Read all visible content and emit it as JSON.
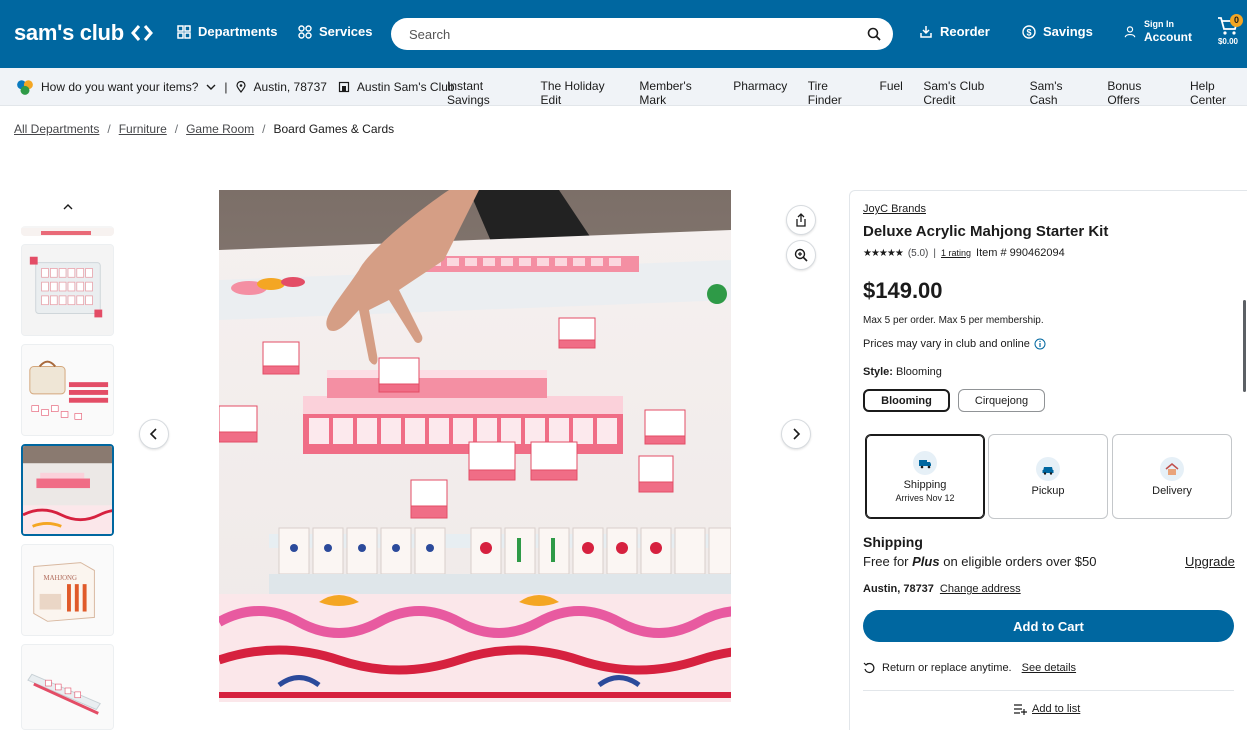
{
  "header": {
    "logo_text": "sam's club",
    "departments_label": "Departments",
    "services_label": "Services",
    "search_placeholder": "Search",
    "reorder_label": "Reorder",
    "savings_label": "Savings",
    "sign_in_label": "Sign In",
    "account_label": "Account",
    "cart_count": "0",
    "cart_total": "$0.00",
    "brand_color": "#0067a0"
  },
  "subnav": {
    "fulfillment_prompt": "How do you want your items?",
    "location": "Austin, 78737",
    "club": "Austin Sam's Club",
    "links": [
      "Instant Savings",
      "The Holiday Edit",
      "Member's Mark",
      "Pharmacy",
      "Tire Finder",
      "Fuel",
      "Sam's Club Credit",
      "Sam's Cash",
      "Bonus Offers",
      "Help Center"
    ]
  },
  "breadcrumbs": {
    "items": [
      "All Departments",
      "Furniture",
      "Game Room"
    ],
    "current": "Board Games & Cards",
    "separator": "/"
  },
  "product": {
    "brand": "JoyC Brands",
    "title": "Deluxe Acrylic Mahjong Starter Kit",
    "stars": "★★★★★",
    "rating_value": "(5.0)",
    "rating_separator": "|",
    "rating_count": "1 rating",
    "item_number": "Item # 990462094",
    "price": "$149.00",
    "limit_text": "Max 5 per order. Max 5 per membership.",
    "price_note": "Prices may vary in club and online",
    "style_label": "Style:",
    "style_value": "Blooming",
    "styles": [
      "Blooming",
      "Cirquejong"
    ]
  },
  "fulfillment": {
    "options": [
      {
        "label": "Shipping",
        "sub": "Arrives Nov 12",
        "icon": "truck-icon"
      },
      {
        "label": "Pickup",
        "sub": "",
        "icon": "car-icon"
      },
      {
        "label": "Delivery",
        "sub": "",
        "icon": "house-icon"
      }
    ],
    "shipping_heading": "Shipping",
    "free_for": "Free for",
    "plus": "Plus",
    "free_rest": "on eligible orders over $50",
    "upgrade": "Upgrade",
    "address": "Austin, 78737",
    "change_address": "Change address",
    "add_to_cart": "Add to Cart",
    "returns_text": "Return or replace anytime.",
    "see_details": "See details",
    "add_to_list": "Add to list"
  }
}
